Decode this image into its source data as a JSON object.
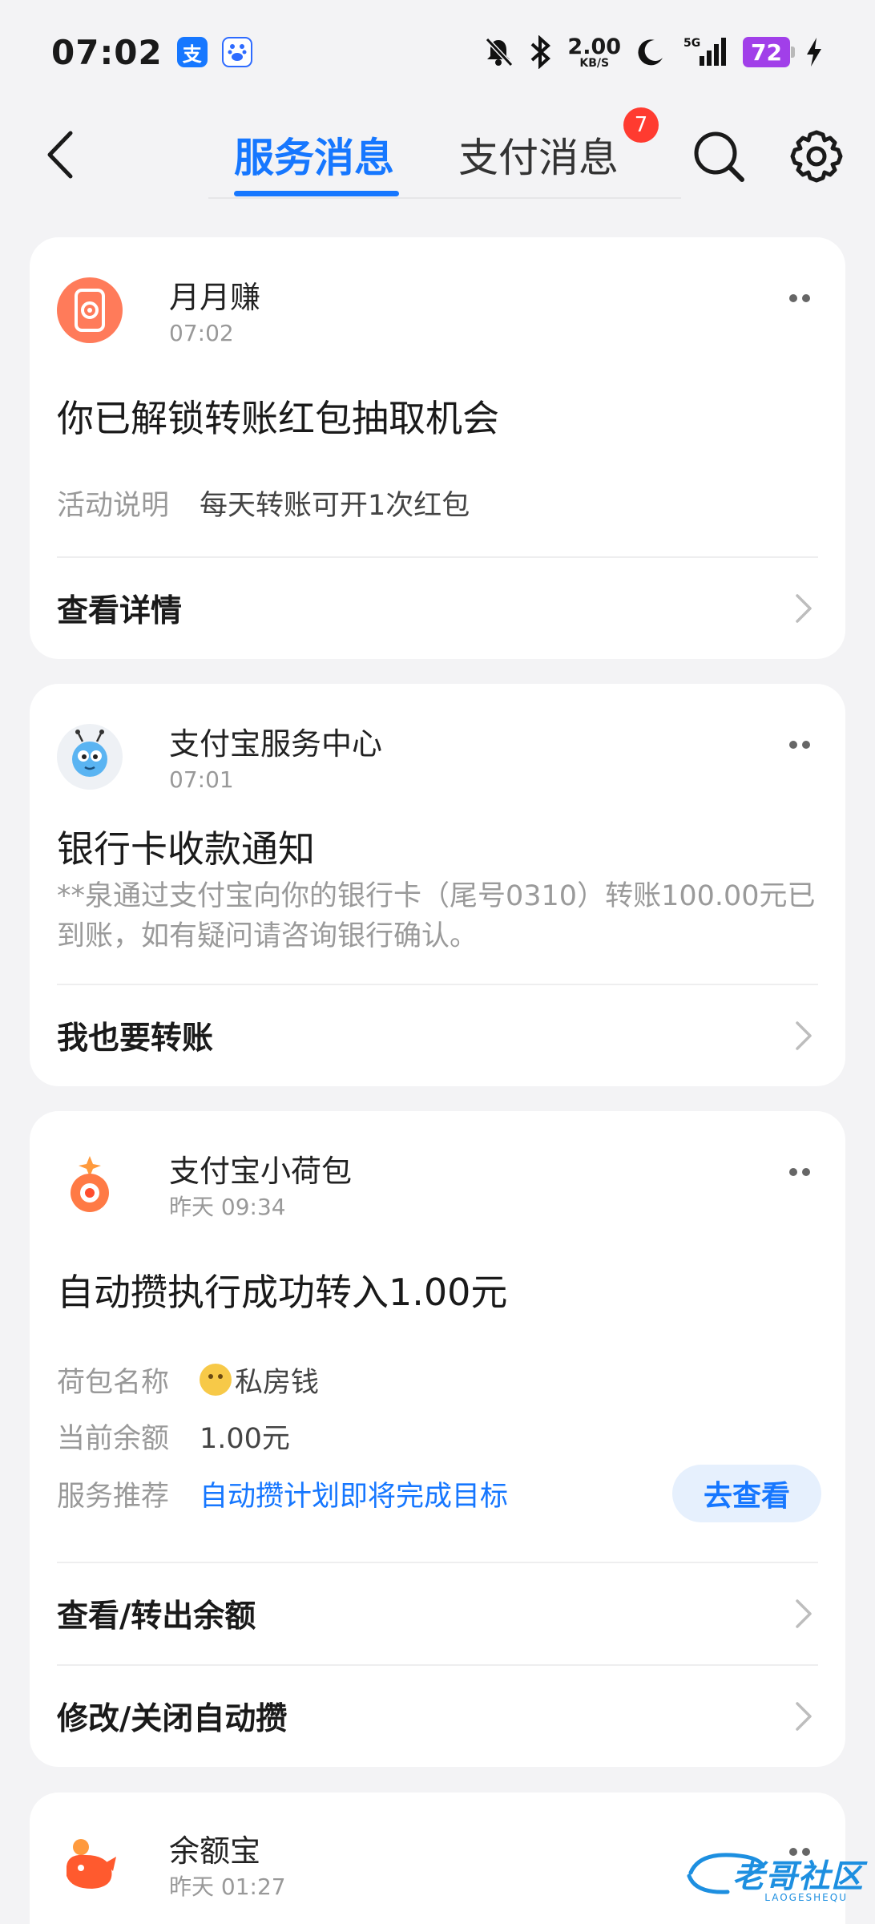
{
  "status_bar": {
    "time": "07:02",
    "net_speed_value": "2.00",
    "net_speed_unit": "KB/S",
    "battery": "72",
    "icons": [
      "alipay-app-icon",
      "baidu-app-icon",
      "mute-icon",
      "bluetooth-icon",
      "moon-icon",
      "5g-signal-icon",
      "charging-icon"
    ]
  },
  "header": {
    "tabs": [
      {
        "label": "服务消息",
        "active": true
      },
      {
        "label": "支付消息",
        "badge": "7"
      }
    ]
  },
  "messages": [
    {
      "sender": "月月赚",
      "time": "07:02",
      "title": "你已解锁转账红包抽取机会",
      "fields": [
        {
          "key": "活动说明",
          "value": "每天转账可开1次红包"
        }
      ],
      "actions": [
        "查看详情"
      ]
    },
    {
      "sender": "支付宝服务中心",
      "time": "07:01",
      "title": "银行卡收款通知",
      "description": "**泉通过支付宝向你的银行卡（尾号0310）转账100.00元已到账，如有疑问请咨询银行确认。",
      "actions": [
        "我也要转账"
      ]
    },
    {
      "sender": "支付宝小荷包",
      "time": "昨天 09:34",
      "title": "自动攒执行成功转入1.00元",
      "fields": [
        {
          "key": "荷包名称",
          "value": "私房钱"
        },
        {
          "key": "当前余额",
          "value": "1.00元"
        },
        {
          "key": "服务推荐",
          "value": "自动攒计划即将完成目标",
          "button": "去查看"
        }
      ],
      "actions": [
        "查看/转出余额",
        "修改/关闭自动攒"
      ]
    },
    {
      "sender": "余额宝",
      "time": "昨天 01:27"
    }
  ],
  "watermark": {
    "text": "老哥社区",
    "sub": "LAOGESHEQU"
  },
  "colors": {
    "accent": "#1677ff",
    "badge": "#ff3b30",
    "background": "#f3f3f5"
  }
}
